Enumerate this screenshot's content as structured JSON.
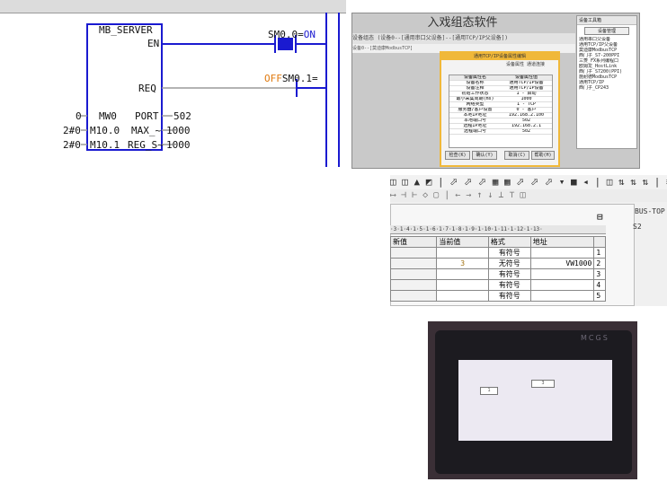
{
  "ladder": {
    "block_name": "MB_SERVER",
    "en_label": "EN",
    "req_label": "REQ",
    "contact1_address": "SM0.0=",
    "contact1_state": "ON",
    "contact2_address": "SM0.1=",
    "contact2_state": "OFF",
    "params": [
      {
        "port": "PORT",
        "value_left": "0",
        "value_right": "502",
        "operand": "MW0"
      },
      {
        "port": "MAX_~",
        "value_left": "2#0",
        "value_right": "1000",
        "operand": "M10.0"
      },
      {
        "port": "REG_S~",
        "value_left": "2#0",
        "value_right": "1000",
        "operand": "M10.1"
      }
    ]
  },
  "config_window": {
    "title": "入戏组态软件",
    "strip_text": "设备组态   (设备0--[通用串口父设备]--[通用TCP/IP父设备])",
    "strip2_text": "设备0--[莫迪康ModbusTCP]",
    "tree_header": "设备工具箱",
    "tree_button": "设备管理",
    "tree_items": [
      "通用串口父设备",
      "通用TCP/IP父设备",
      "莫迪康ModbusTCP",
      "西门子_S7-200PPI",
      "三菱_FX系列编程口",
      "欧姆龙_HostLink",
      "西门子_S7200(PPI)",
      "施耐德ModbusTCP",
      "通用TCP/IP",
      "西门子_CP243"
    ],
    "dialog_title": "通用TCP/IP设备属性编辑",
    "dialog_tabs": "设备属性   通道连接",
    "table_header": [
      "设备属性名",
      "设备属性值"
    ],
    "table_rows": [
      [
        "设备名称",
        "通用TCP/IP设备"
      ],
      [
        "设备注释",
        "通用TCP/IP设备"
      ],
      [
        "初始工作状态",
        "1 - 启动"
      ],
      [
        "最小采集周期(ms)",
        "1000"
      ],
      [
        "网络类型",
        "1 - TCP"
      ],
      [
        "服务器/客户设置",
        "0 - 客户"
      ],
      [
        "本地IP地址",
        "192.168.2.100"
      ],
      [
        "本地端口号",
        "502"
      ],
      [
        "远程IP地址",
        "192.168.2.1"
      ],
      [
        "远程端口号",
        "502"
      ]
    ],
    "buttons": [
      "检查(K)",
      "确认(Y)",
      "取消(C)",
      "帮助(H)"
    ]
  },
  "status_chart": {
    "toolbar_text": "◫ ◫ ▲ ◩ | ⬀ ⬀ ⬀ ▦ ▦ ⬀ ⬀ ⬀ ▾ ■ ◂ | ◫ ⇅ ⇅ ⇅ | ≡ ≡ ≡ ◪ ◪ ⊠",
    "toolbar2_text": "⟷  ⊣ ⊢ ◇ ▢ |  ←  →  ↑  ↓  ⊥  ⊤ ◫",
    "side_label_1": "BUS-TOP",
    "side_label_2": "S2",
    "ruler_text": "·3·1·4·1·5·1·6·1·7·1·8·1·9·1·10·1·11·1·12·1·13·",
    "columns": [
      "",
      "地址",
      "格式",
      "当前值",
      "新值"
    ],
    "rows": [
      {
        "n": "1",
        "address": "",
        "format": "有符号",
        "current": "",
        "new": ""
      },
      {
        "n": "2",
        "address": "VW1000",
        "format": "无符号",
        "current": "3",
        "new": ""
      },
      {
        "n": "3",
        "address": "",
        "format": "有符号",
        "current": "",
        "new": ""
      },
      {
        "n": "4",
        "address": "",
        "format": "有符号",
        "current": "",
        "new": ""
      },
      {
        "n": "5",
        "address": "",
        "format": "有符号",
        "current": "",
        "new": ""
      }
    ]
  },
  "hmi_photo": {
    "brand": "MCGS",
    "field1_value": "1",
    "field2_value": "3"
  }
}
